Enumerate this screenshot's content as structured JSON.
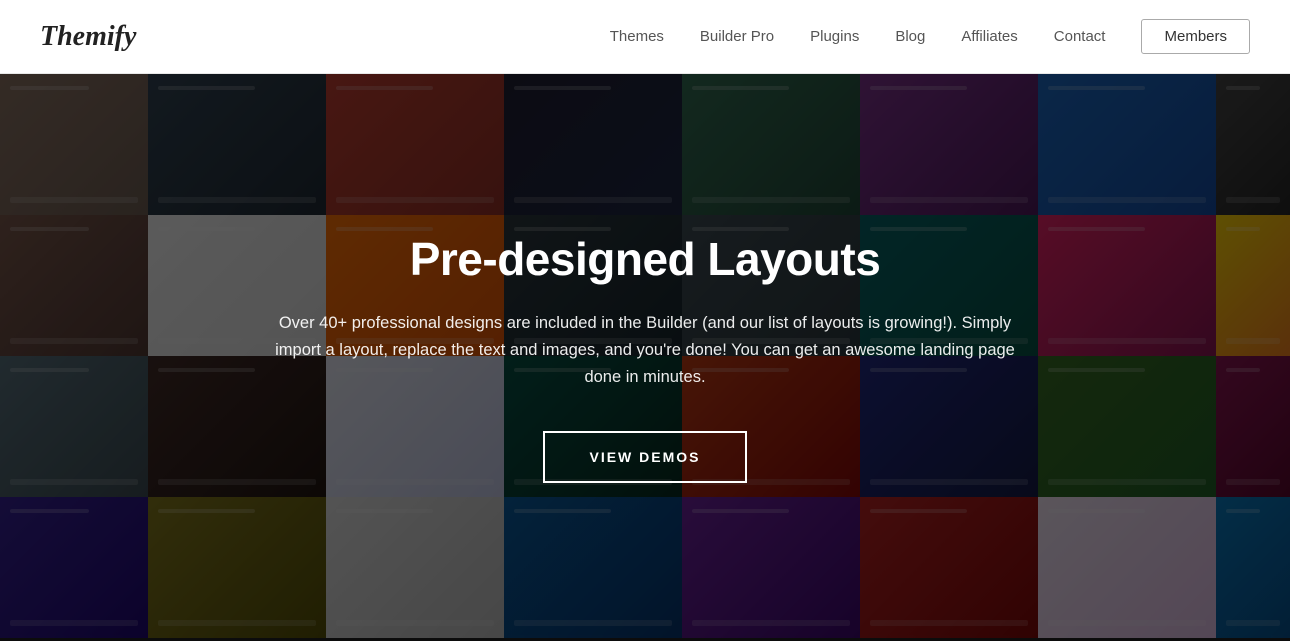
{
  "header": {
    "logo": "Themify",
    "nav": {
      "items": [
        {
          "label": "Themes",
          "id": "themes"
        },
        {
          "label": "Builder Pro",
          "id": "builder-pro"
        },
        {
          "label": "Plugins",
          "id": "plugins"
        },
        {
          "label": "Blog",
          "id": "blog"
        },
        {
          "label": "Affiliates",
          "id": "affiliates"
        },
        {
          "label": "Contact",
          "id": "contact"
        }
      ],
      "cta_label": "Members"
    }
  },
  "hero": {
    "title": "Pre-designed Layouts",
    "description": "Over 40+ professional designs are included in the Builder (and our list of layouts is growing!). Simply import a layout, replace the text and images, and you're done! You can get an awesome landing page done in minutes.",
    "cta_label": "VIEW DEMOS"
  }
}
